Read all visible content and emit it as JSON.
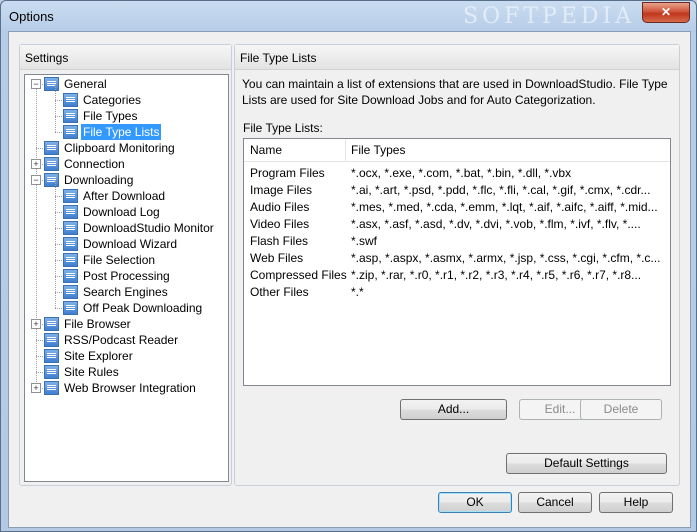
{
  "window": {
    "title": "Options",
    "close_glyph": "✕",
    "watermark": "SOFTPEDIA"
  },
  "settings_panel": {
    "header": "Settings",
    "tree": [
      {
        "label": "General",
        "level": 0,
        "expander": "−",
        "selected": false
      },
      {
        "label": "Categories",
        "level": 1,
        "selected": false
      },
      {
        "label": "File Types",
        "level": 1,
        "selected": false
      },
      {
        "label": "File Type Lists",
        "level": 1,
        "selected": true
      },
      {
        "label": "Clipboard Monitoring",
        "level": 0,
        "selected": false
      },
      {
        "label": "Connection",
        "level": 0,
        "expander": "+",
        "selected": false
      },
      {
        "label": "Downloading",
        "level": 0,
        "expander": "−",
        "selected": false
      },
      {
        "label": "After Download",
        "level": 1,
        "selected": false
      },
      {
        "label": "Download Log",
        "level": 1,
        "selected": false
      },
      {
        "label": "DownloadStudio Monitor",
        "level": 1,
        "selected": false
      },
      {
        "label": "Download Wizard",
        "level": 1,
        "selected": false
      },
      {
        "label": "File Selection",
        "level": 1,
        "selected": false
      },
      {
        "label": "Post Processing",
        "level": 1,
        "selected": false
      },
      {
        "label": "Search Engines",
        "level": 1,
        "selected": false
      },
      {
        "label": "Off Peak Downloading",
        "level": 1,
        "selected": false
      },
      {
        "label": "File Browser",
        "level": 0,
        "expander": "+",
        "selected": false
      },
      {
        "label": "RSS/Podcast Reader",
        "level": 0,
        "selected": false
      },
      {
        "label": "Site Explorer",
        "level": 0,
        "selected": false
      },
      {
        "label": "Site Rules",
        "level": 0,
        "selected": false
      },
      {
        "label": "Web Browser Integration",
        "level": 0,
        "expander": "+",
        "selected": false
      }
    ]
  },
  "content_panel": {
    "header": "File Type Lists",
    "description": "You can maintain a list of extensions that are used in DownloadStudio.  File Type Lists are used for Site Download Jobs and for Auto Categorization.",
    "list_label": "File Type Lists:",
    "columns": {
      "name": "Name",
      "types": "File Types"
    },
    "rows": [
      {
        "name": "Program Files",
        "types": "*.ocx, *.exe, *.com, *.bat, *.bin, *.dll, *.vbx"
      },
      {
        "name": "Image Files",
        "types": "*.ai, *.art, *.psd, *.pdd, *.flc, *.fli, *.cal, *.gif, *.cmx, *.cdr..."
      },
      {
        "name": "Audio Files",
        "types": "*.mes, *.med, *.cda, *.emm, *.lqt, *.aif, *.aifc, *.aiff, *.mid..."
      },
      {
        "name": "Video Files",
        "types": "*.asx, *.asf, *.asd, *.dv, *.dvi, *.vob, *.flm, *.ivf, *.flv, *...."
      },
      {
        "name": "Flash Files",
        "types": "*.swf"
      },
      {
        "name": "Web Files",
        "types": "*.asp, *.aspx, *.asmx, *.armx, *.jsp, *.css, *.cgi, *.cfm, *.c..."
      },
      {
        "name": "Compressed Files",
        "types": "*.zip, *.rar, *.r0, *.r1, *.r2, *.r3, *.r4, *.r5, *.r6, *.r7, *.r8..."
      },
      {
        "name": "Other Files",
        "types": "*.*"
      }
    ],
    "buttons": {
      "add": "Add...",
      "edit": "Edit...",
      "delete": "Delete",
      "default_settings": "Default Settings"
    }
  },
  "dialog_buttons": {
    "ok": "OK",
    "cancel": "Cancel",
    "help": "Help"
  }
}
